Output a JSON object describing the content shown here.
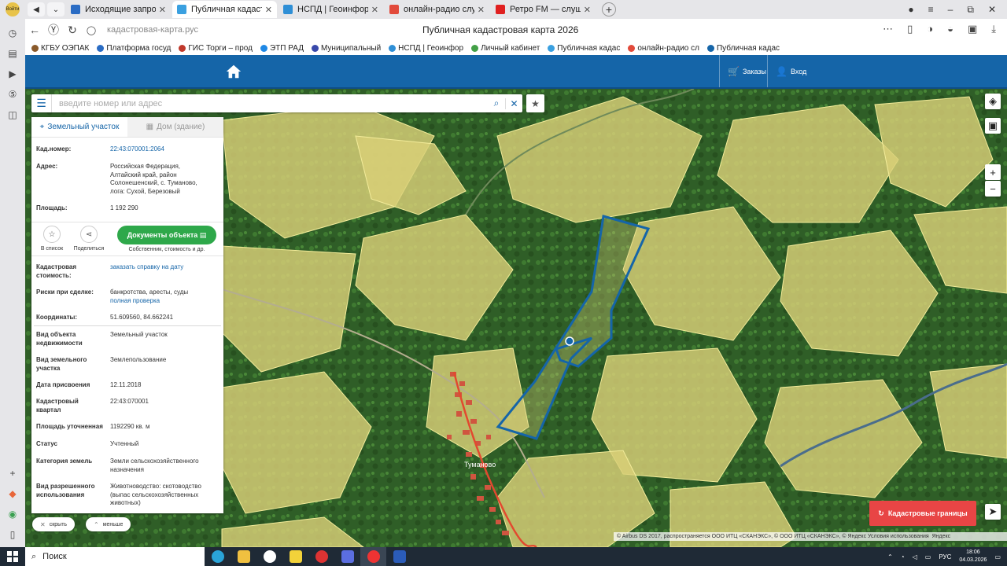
{
  "browser": {
    "profile_label": "Войти",
    "tabs": [
      {
        "label": "Исходящие запросы СМЭ",
        "active": false,
        "color": "#2a6cc4"
      },
      {
        "label": "Публичная кадастровая",
        "active": true,
        "color": "#3aa0e0"
      },
      {
        "label": "НСПД | Геоинформацион",
        "active": false,
        "color": "#2f8fd6"
      },
      {
        "label": "онлайн-радио слушать бе",
        "active": false,
        "color": "#e24a3b"
      },
      {
        "label": "Ретро FM — слушать",
        "active": false,
        "color": "#e02020"
      }
    ],
    "url": "кадастровая-карта.рус",
    "page_title": "Публичная кадастровая карта 2026",
    "bookmarks": [
      {
        "label": "КГБУ ОЭПАК",
        "color": "#8a5a2b"
      },
      {
        "label": "Платформа госуд",
        "color": "#2a6cc4"
      },
      {
        "label": "ГИС Торги – прод",
        "color": "#c0392b"
      },
      {
        "label": "ЭТП РАД",
        "color": "#1e88e5"
      },
      {
        "label": "Муниципальный",
        "color": "#3949ab"
      },
      {
        "label": "НСПД | Геоинфор",
        "color": "#2f8fd6"
      },
      {
        "label": "Личный кабинет",
        "color": "#43a047"
      },
      {
        "label": "Публичная кадас",
        "color": "#3aa0e0"
      },
      {
        "label": "онлайн-радио сл",
        "color": "#e24a3b"
      },
      {
        "label": "Публичная кадас",
        "color": "#1565a8"
      }
    ]
  },
  "header": {
    "orders_label": "Заказы",
    "login_label": "Вход"
  },
  "search": {
    "placeholder": "введите номер или адрес"
  },
  "panel": {
    "tab_land": "Земельный участок",
    "tab_building": "Дом (здание)",
    "cad_num_label": "Кад.номер:",
    "cad_num_value": "22:43:070001:2064",
    "address_label": "Адрес:",
    "address_lines": [
      "Российская Федерация,",
      "Алтайский край, район",
      "Солонешенский, с. Туманово,",
      "лога: Сухой, Березовый"
    ],
    "area_label": "Площадь:",
    "area_value": "1 192 290",
    "to_list_label": "В список",
    "share_label": "Поделиться",
    "docs_button": "Документы объекта",
    "docs_sub": "Собственник, стоимость и др.",
    "cad_cost_label_1": "Кадастровая",
    "cad_cost_label_2": "стоимость:",
    "cad_cost_value": "заказать справку на дату",
    "risks_label": "Риски при сделке:",
    "risks_value": "банкротства, аресты, суды",
    "risks_link": "полная проверка",
    "coords_label": "Координаты:",
    "coords_value": "51.609560, 84.662241",
    "obj_type_label_1": "Вид объекта",
    "obj_type_label_2": "недвижимости",
    "obj_type_value": "Земельный участок",
    "plot_type_label_1": "Вид земельного",
    "plot_type_label_2": "участка",
    "plot_type_value": "Землепользование",
    "date_label": "Дата присвоения",
    "date_value": "12.11.2018",
    "quarter_label_1": "Кадастровый",
    "quarter_label_2": "квартал",
    "quarter_value": "22:43:070001",
    "refined_label": "Площадь уточненная",
    "refined_value": "1192290 кв. м",
    "status_label": "Статус",
    "status_value": "Учтенный",
    "category_label": "Категория земель",
    "category_lines": [
      "Земли сельскохозяйственного",
      "назначения"
    ],
    "usage_label_1": "Вид разрешенного",
    "usage_label_2": "использования",
    "usage_lines": [
      "Животноводство: скотоводство",
      "(выпас сельскохозяйственных",
      "животных)"
    ]
  },
  "pills": {
    "hide": "скрыть",
    "less": "меньше"
  },
  "map": {
    "cad_borders_button": "Кадастровые границы",
    "village_label": "Туманово",
    "attribution": "© Airbus DS 2017, распространяется ООО ИТЦ «СКАНЭКС», © ООО ИТЦ «СКАНЭКС», © Яндекс Условия использования",
    "yandex_label": "Яндекс"
  },
  "taskbar": {
    "search_label": "Поиск",
    "lang": "РУС",
    "time": "18:06",
    "date": "04.03.2026"
  }
}
